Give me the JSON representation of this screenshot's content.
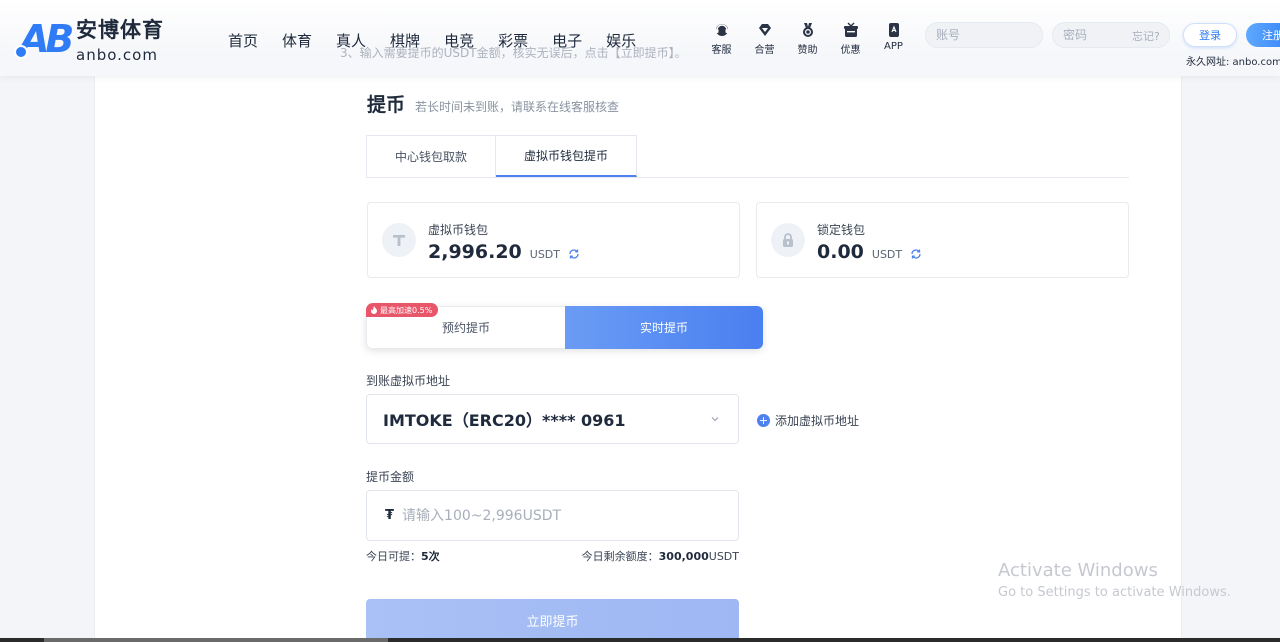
{
  "header": {
    "logo_cn": "安博体育",
    "logo_en": "anbo.com",
    "nav": [
      "首页",
      "体育",
      "真人",
      "棋牌",
      "电竞",
      "彩票",
      "电子",
      "娱乐"
    ],
    "icons": [
      {
        "label": "客服",
        "icon": "customer-service-icon"
      },
      {
        "label": "合营",
        "icon": "partner-diamond-icon"
      },
      {
        "label": "赞助",
        "icon": "sponsor-medal-icon"
      },
      {
        "label": "优惠",
        "icon": "promo-gift-icon"
      },
      {
        "label": "APP",
        "icon": "app-phone-icon"
      }
    ],
    "account_placeholder": "账号",
    "password_placeholder": "密码",
    "forgot_label": "忘记?",
    "login_label": "登录",
    "register_label": "注册",
    "permanent_url": "永久网址: anbo.com"
  },
  "ghost_text": "3、输入需要提币的USDT金额，核实无误后，点击【立即提币】。",
  "page": {
    "title": "提币",
    "subtitle": "若长时间未到账，请联系在线客服核查",
    "tabs": [
      "中心钱包取款",
      "虚拟币钱包提币"
    ],
    "active_tab": 1
  },
  "wallets": [
    {
      "label": "虚拟币钱包",
      "amount": "2,996.20",
      "unit": "USDT",
      "icon": "tether-icon"
    },
    {
      "label": "锁定钱包",
      "amount": "0.00",
      "unit": "USDT",
      "icon": "lock-icon"
    }
  ],
  "mode": {
    "badge": "最高加速0.5%",
    "reserve_label": "预约提币",
    "live_label": "实时提币",
    "selected": "live"
  },
  "address": {
    "label": "到账虚拟币地址",
    "value": "IMTOKE（ERC20）**** 0961",
    "add_label": "添加虚拟币地址"
  },
  "amount": {
    "label": "提币金额",
    "placeholder": "请输入100~2,996USDT",
    "today_label": "今日可提：",
    "today_value": "5次",
    "remaining_label": "今日剩余额度：",
    "remaining_value": "300,000",
    "remaining_unit": "USDT"
  },
  "submit_label": "立即提币",
  "watermark": {
    "title": "Activate Windows",
    "subtitle": "Go to Settings to activate Windows."
  },
  "colors": {
    "accent": "#4f82ee",
    "brand": "#2f7cf6",
    "badge": "#e8566a"
  }
}
